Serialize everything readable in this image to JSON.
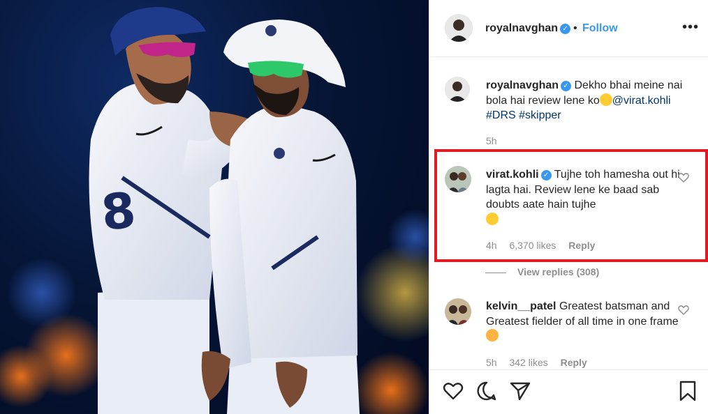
{
  "post": {
    "author": "royalnavghan",
    "follow_label": "Follow",
    "dot": "•",
    "more_label": "•••"
  },
  "caption": {
    "username": "royalnavghan",
    "text": "Dekho bhai meine nai bola hai review lene ko",
    "mention": "@virat.kohli",
    "hashtags": "#DRS #skipper",
    "time": "5h"
  },
  "comments": [
    {
      "username": "virat.kohli",
      "verified": true,
      "text": "Tujhe toh hamesha out hi lagta hai. Review lene ke baad sab doubts aate hain tujhe",
      "time": "4h",
      "likes": "6,370 likes",
      "reply_label": "Reply",
      "view_replies": "View replies (308)"
    },
    {
      "username": "kelvin__patel",
      "verified": false,
      "text": "Greatest batsman and Greatest fielder of all time in one frame",
      "time": "5h",
      "likes": "342 likes",
      "reply_label": "Reply"
    }
  ],
  "colors": {
    "accent_blue": "#3897f0",
    "highlight_red": "#e01b23",
    "muted_text": "#8e8e8e"
  },
  "icons": [
    "heart-icon",
    "comment-icon",
    "share-icon",
    "bookmark-icon",
    "verified-badge-icon",
    "more-options-icon"
  ]
}
